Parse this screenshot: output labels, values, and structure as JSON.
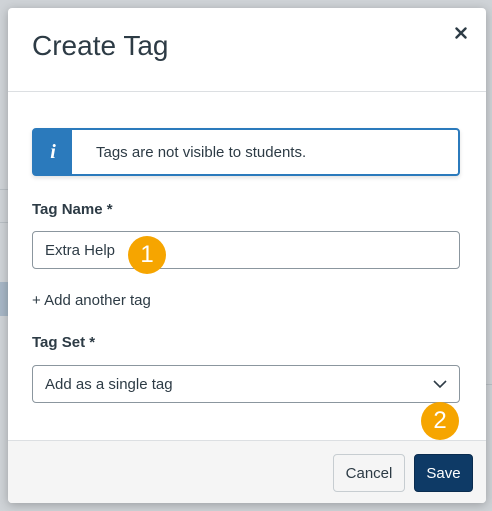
{
  "dialog": {
    "title": "Create Tag",
    "close_label": "×"
  },
  "alert": {
    "icon": "i",
    "text": "Tags are not visible to students."
  },
  "form": {
    "tag_name_label": "Tag Name *",
    "tag_name_value": "Extra Help",
    "add_another_label": "+ Add another tag",
    "tag_set_label": "Tag Set *",
    "tag_set_value": "Add as a single tag"
  },
  "footer": {
    "cancel_label": "Cancel",
    "save_label": "Save"
  },
  "callouts": {
    "step1": "1",
    "step2": "2"
  },
  "colors": {
    "accent": "#2b7abc",
    "primary_button": "#0e3a66",
    "callout": "#f6a500"
  }
}
